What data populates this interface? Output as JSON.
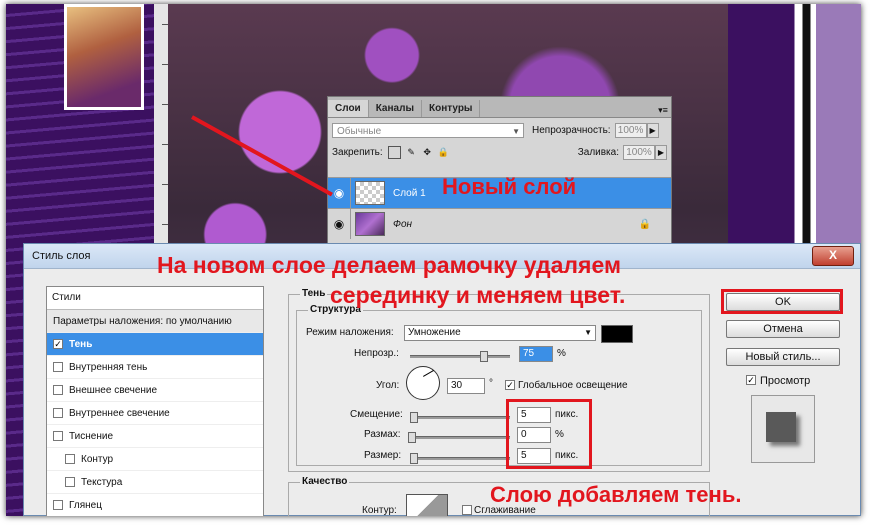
{
  "layers_panel": {
    "tabs": [
      "Слои",
      "Каналы",
      "Контуры"
    ],
    "blend_mode": "Обычные",
    "opacity_label": "Непрозрачность:",
    "opacity_value": "100%",
    "lock_label": "Закрепить:",
    "fill_label": "Заливка:",
    "fill_value": "100%",
    "layers": [
      {
        "name": "Слой 1",
        "selected": true
      },
      {
        "name": "Фон",
        "selected": false,
        "locked": true
      }
    ]
  },
  "dialog": {
    "title": "Стиль слоя",
    "close_label": "X",
    "styles_header": "Стили",
    "styles_items": [
      "Параметры наложения: по умолчанию",
      "Тень",
      "Внутренняя тень",
      "Внешнее свечение",
      "Внутреннее свечение",
      "Тиснение",
      "Контур",
      "Текстура",
      "Глянец"
    ],
    "section_title": "Тень",
    "structure_title": "Структура",
    "blend_mode_label": "Режим наложения:",
    "blend_mode_value": "Умножение",
    "opacity_label": "Непрозр.:",
    "opacity_value": "75",
    "percent": "%",
    "angle_label": "Угол:",
    "angle_value": "30",
    "degree": "°",
    "global_light_label": "Глобальное освещение",
    "distance_label": "Смещение:",
    "distance_value": "5",
    "spread_label": "Размах:",
    "spread_value": "0",
    "size_label": "Размер:",
    "size_value": "5",
    "px_unit": "пикс.",
    "quality_title": "Качество",
    "contour_label": "Контур:",
    "antialias_label": "Сглаживание",
    "ok_label": "OK",
    "cancel_label": "Отмена",
    "new_style_label": "Новый стиль...",
    "preview_label": "Просмотр"
  },
  "annotations": {
    "new_layer": "Новый слой",
    "frame_line1": "На новом слое делаем рамочку удаляем",
    "frame_line2": "серединку и меняем цвет.",
    "shadow": "Слою добавляем тень."
  },
  "colors": {
    "annotation_red": "#e2161e",
    "selection_blue": "#3b8fe6"
  }
}
